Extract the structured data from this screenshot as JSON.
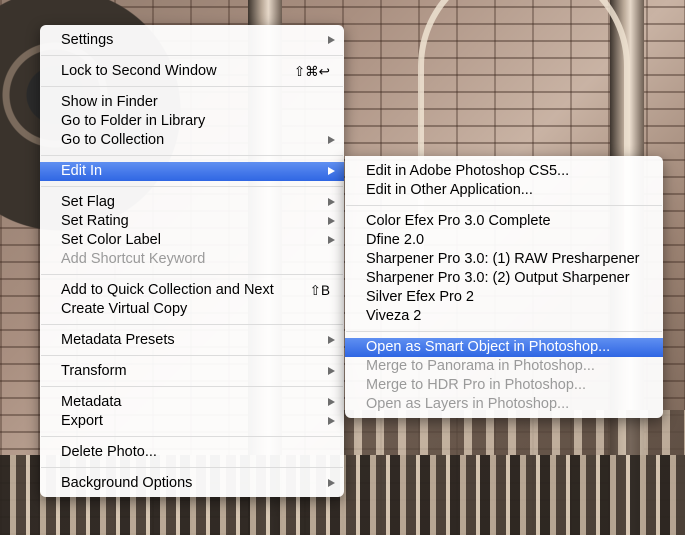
{
  "main_menu": {
    "settings": "Settings",
    "lock_second_window": "Lock to Second Window",
    "lock_shortcut": "⇧⌘↩",
    "show_in_finder": "Show in Finder",
    "go_to_folder": "Go to Folder in Library",
    "go_to_collection": "Go to Collection",
    "edit_in": "Edit In",
    "set_flag": "Set Flag",
    "set_rating": "Set Rating",
    "set_color_label": "Set Color Label",
    "add_shortcut_keyword": "Add Shortcut Keyword",
    "add_quick_collection": "Add to Quick Collection and Next",
    "add_quick_shortcut": "⇧B",
    "create_virtual_copy": "Create Virtual Copy",
    "metadata_presets": "Metadata Presets",
    "transform": "Transform",
    "metadata": "Metadata",
    "export": "Export",
    "delete_photo": "Delete Photo...",
    "background_options": "Background Options"
  },
  "edit_in_submenu": {
    "edit_photoshop_cs5": "Edit in Adobe Photoshop CS5...",
    "edit_other_app": "Edit in Other Application...",
    "color_efex": "Color Efex Pro 3.0 Complete",
    "dfine": "Dfine 2.0",
    "sharpener_raw": "Sharpener Pro 3.0: (1) RAW Presharpener",
    "sharpener_output": "Sharpener Pro 3.0: (2) Output Sharpener",
    "silver_efex": "Silver Efex Pro 2",
    "viveza": "Viveza 2",
    "open_smart_object": "Open as Smart Object in Photoshop...",
    "merge_panorama": "Merge to Panorama in Photoshop...",
    "merge_hdr": "Merge to HDR Pro in Photoshop...",
    "open_layers": "Open as Layers in Photoshop..."
  },
  "colors": {
    "selection": "#3a6fe8",
    "disabled_text": "#9a9a9a"
  }
}
